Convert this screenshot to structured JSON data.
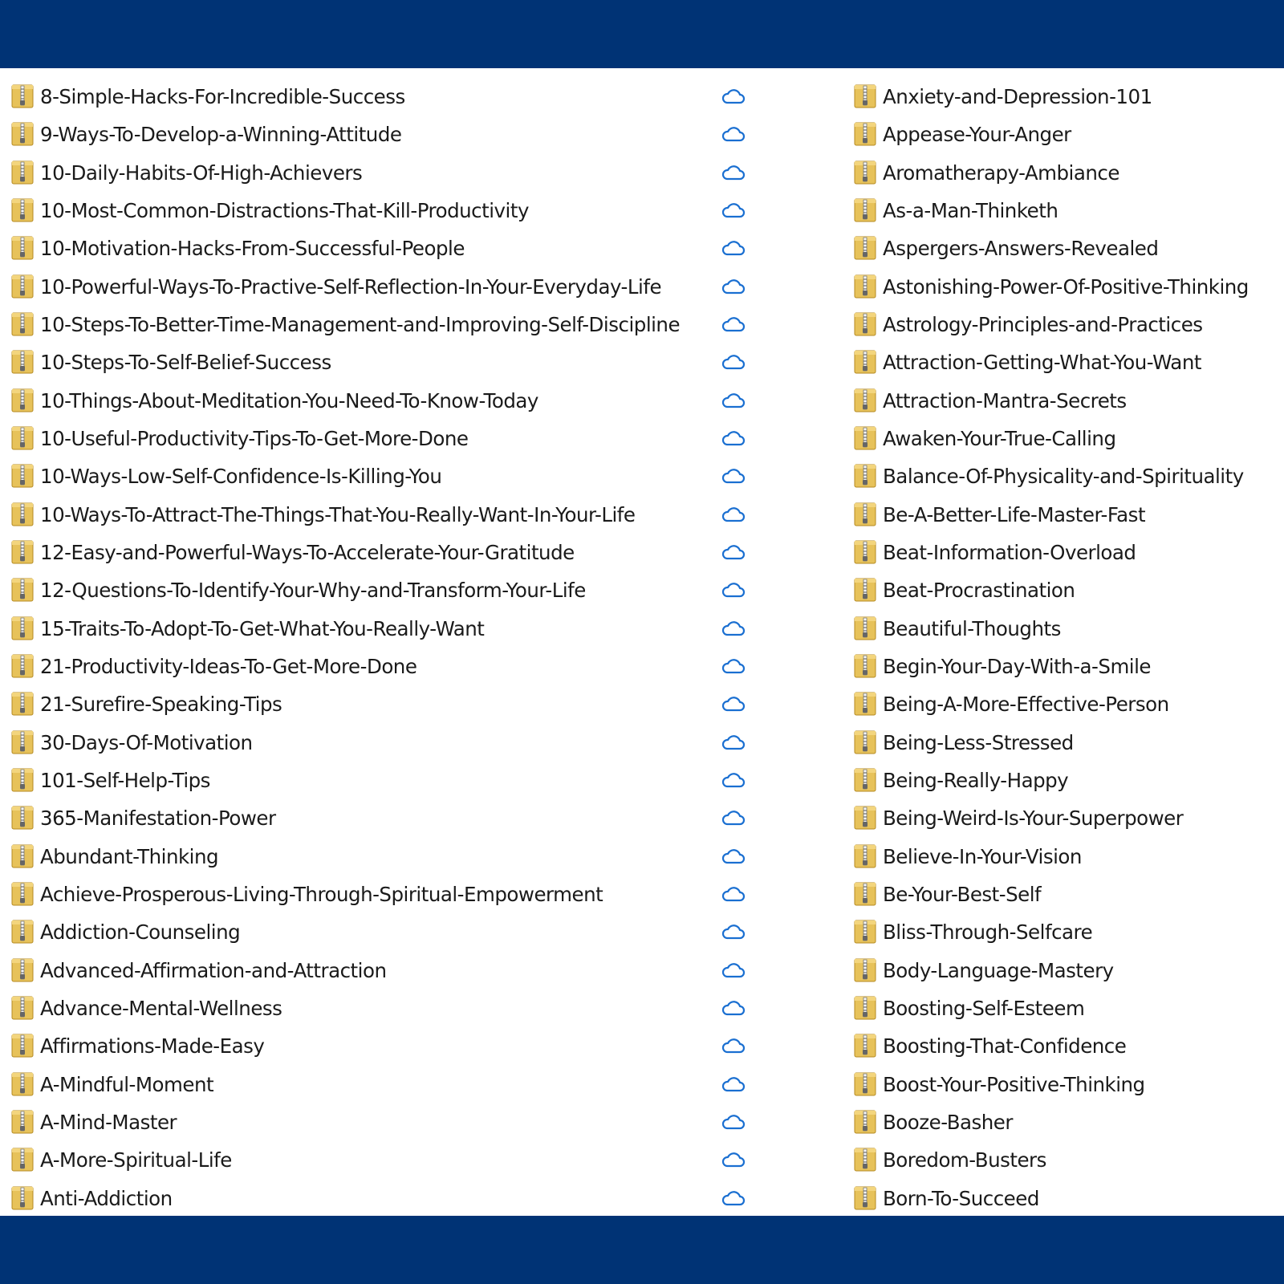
{
  "colors": {
    "frame": "#003375",
    "panel": "#ffffff",
    "text": "#1a1a1a",
    "cloud_icon": "#1a6fd1",
    "zip_icon": "#e7c25a"
  },
  "icons": {
    "file": "zip-folder-icon",
    "status": "cloud-sync-icon"
  },
  "left_files": [
    "8-Simple-Hacks-For-Incredible-Success",
    "9-Ways-To-Develop-a-Winning-Attitude",
    "10-Daily-Habits-Of-High-Achievers",
    "10-Most-Common-Distractions-That-Kill-Productivity",
    "10-Motivation-Hacks-From-Successful-People",
    "10-Powerful-Ways-To-Practive-Self-Reflection-In-Your-Everyday-Life",
    "10-Steps-To-Better-Time-Management-and-Improving-Self-Discipline",
    "10-Steps-To-Self-Belief-Success",
    "10-Things-About-Meditation-You-Need-To-Know-Today",
    "10-Useful-Productivity-Tips-To-Get-More-Done",
    "10-Ways-Low-Self-Confidence-Is-Killing-You",
    "10-Ways-To-Attract-The-Things-That-You-Really-Want-In-Your-Life",
    "12-Easy-and-Powerful-Ways-To-Accelerate-Your-Gratitude",
    "12-Questions-To-Identify-Your-Why-and-Transform-Your-Life",
    "15-Traits-To-Adopt-To-Get-What-You-Really-Want",
    "21-Productivity-Ideas-To-Get-More-Done",
    "21-Surefire-Speaking-Tips",
    "30-Days-Of-Motivation",
    "101-Self-Help-Tips",
    "365-Manifestation-Power",
    "Abundant-Thinking",
    "Achieve-Prosperous-Living-Through-Spiritual-Empowerment",
    "Addiction-Counseling",
    "Advanced-Affirmation-and-Attraction",
    "Advance-Mental-Wellness",
    "Affirmations-Made-Easy",
    "A-Mindful-Moment",
    "A-Mind-Master",
    "A-More-Spiritual-Life",
    "Anti-Addiction"
  ],
  "right_files": [
    "Anxiety-and-Depression-101",
    "Appease-Your-Anger",
    "Aromatherapy-Ambiance",
    "As-a-Man-Thinketh",
    "Aspergers-Answers-Revealed",
    "Astonishing-Power-Of-Positive-Thinking",
    "Astrology-Principles-and-Practices",
    "Attraction-Getting-What-You-Want",
    "Attraction-Mantra-Secrets",
    "Awaken-Your-True-Calling",
    "Balance-Of-Physicality-and-Spirituality",
    "Be-A-Better-Life-Master-Fast",
    "Beat-Information-Overload",
    "Beat-Procrastination",
    "Beautiful-Thoughts",
    "Begin-Your-Day-With-a-Smile",
    "Being-A-More-Effective-Person",
    "Being-Less-Stressed",
    "Being-Really-Happy",
    "Being-Weird-Is-Your-Superpower",
    "Believe-In-Your-Vision",
    "Be-Your-Best-Self",
    "Bliss-Through-Selfcare",
    "Body-Language-Mastery",
    "Boosting-Self-Esteem",
    "Boosting-That-Confidence",
    "Boost-Your-Positive-Thinking",
    "Booze-Basher",
    "Boredom-Busters",
    "Born-To-Succeed"
  ]
}
